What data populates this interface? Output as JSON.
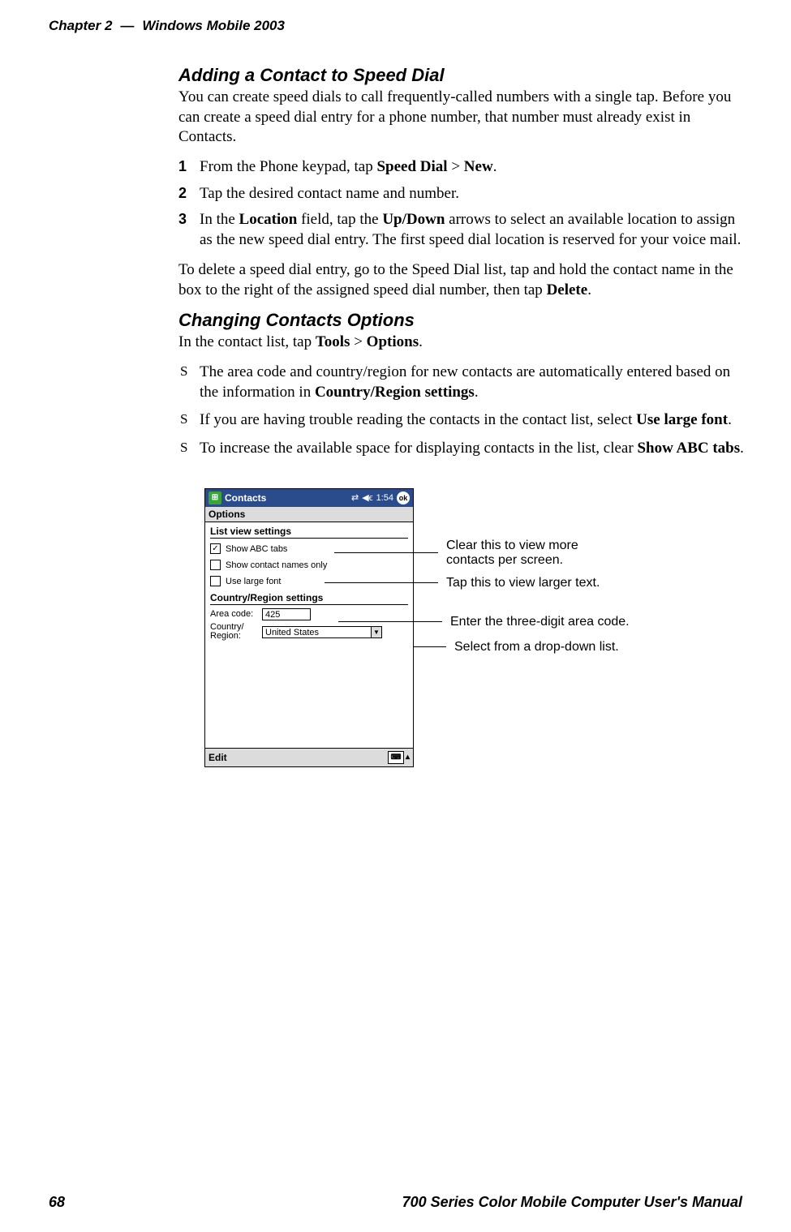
{
  "header": {
    "chapter": "Chapter 2",
    "separator": "—",
    "title": "Windows Mobile 2003"
  },
  "s1": {
    "heading": "Adding a Contact to Speed Dial",
    "intro": "You can create speed dials to call frequently-called numbers with a single tap. Before you can create a speed dial entry for a phone number, that number must already exist in Contacts.",
    "step1_a": "From the Phone keypad, tap ",
    "step1_b": "Speed Dial",
    "step1_c": " > ",
    "step1_d": "New",
    "step1_e": ".",
    "step2": "Tap the desired contact name and number.",
    "step3_a": "In the ",
    "step3_b": "Location",
    "step3_c": " field, tap the ",
    "step3_d": "Up/Down",
    "step3_e": " arrows to select an available location to assign as the new speed dial entry. The first speed dial location is reserved for your voice mail.",
    "outro_a": "To delete a speed dial entry, go to the Speed Dial list, tap and hold the contact name in the box to the right of the assigned speed dial number, then tap ",
    "outro_b": "Delete",
    "outro_c": "."
  },
  "s2": {
    "heading": "Changing Contacts Options",
    "intro_a": "In the contact list, tap ",
    "intro_b": "Tools",
    "intro_c": " > ",
    "intro_d": "Options",
    "intro_e": ".",
    "b1_a": "The area code and country/region for new contacts are automatically entered based on the information in ",
    "b1_b": "Country/Region settings",
    "b1_c": ".",
    "b2_a": "If you are having trouble reading the contacts in the contact list, select ",
    "b2_b": "Use large font",
    "b2_c": ".",
    "b3_a": "To increase the available space for displaying contacts in the list, clear ",
    "b3_b": "Show ABC tabs",
    "b3_c": "."
  },
  "device": {
    "app": "Contacts",
    "time": "1:54",
    "ok": "ok",
    "subtitle": "Options",
    "g1": "List view settings",
    "opt1": "Show ABC tabs",
    "opt1_checked": "✓",
    "opt2": "Show contact names only",
    "opt3": "Use large font",
    "g2": "Country/Region settings",
    "areacode_lbl": "Area code:",
    "areacode_val": "425",
    "country_lbl": "Country/\nRegion:",
    "country_val": "United States",
    "edit": "Edit"
  },
  "callouts": {
    "c1a": "Clear this to view more",
    "c1b": "contacts per screen.",
    "c2": "Tap this to view larger text.",
    "c3": "Enter the three-digit area code.",
    "c4": "Select from a drop-down list."
  },
  "footer": {
    "page": "68",
    "title": "700 Series Color Mobile Computer User's Manual"
  }
}
